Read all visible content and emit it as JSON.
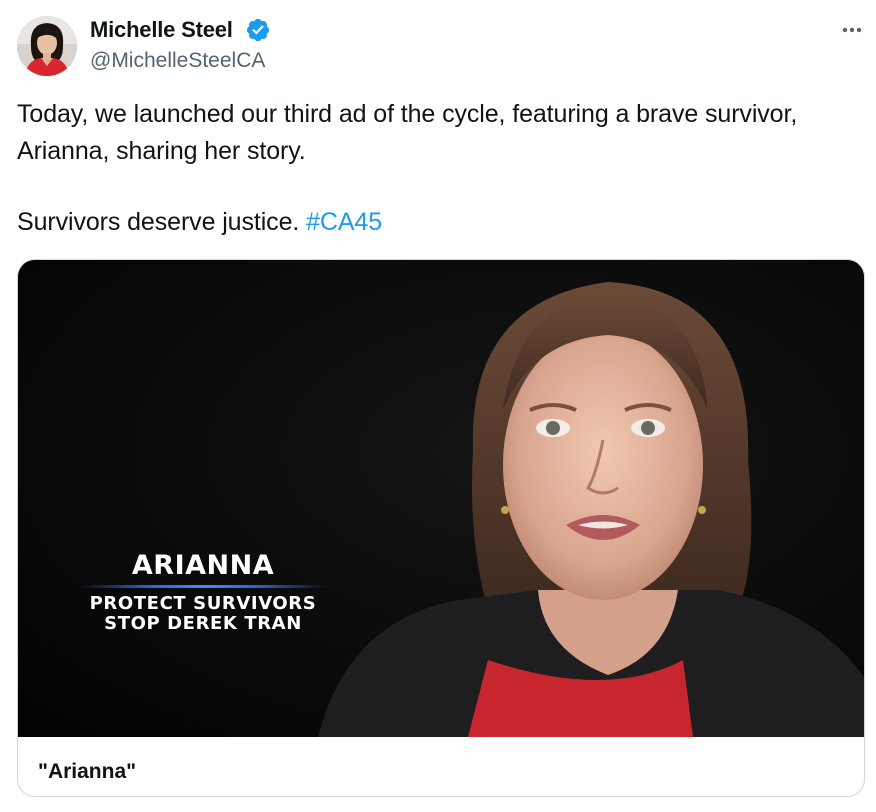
{
  "author": {
    "name": "Michelle Steel",
    "handle": "@MichelleSteelCA",
    "verified_icon": "verified-badge-icon",
    "avatar_description": "avatar"
  },
  "menu": {
    "icon": "more-horizontal-icon"
  },
  "tweet": {
    "line1": "Today, we launched our third ad of the cycle, featuring a brave survivor, Arianna, sharing her story.",
    "line2_text": "Survivors deserve justice.",
    "hashtag": "#CA45"
  },
  "card": {
    "title": "\"Arianna\"",
    "overlay": {
      "name": "ARIANNA",
      "line1": "PROTECT SURVIVORS",
      "line2": "STOP DEREK TRAN"
    }
  },
  "colors": {
    "link": "#1d9bf0",
    "secondary_text": "#536471",
    "verified": "#1d9bf0",
    "border": "#cfd9de"
  }
}
